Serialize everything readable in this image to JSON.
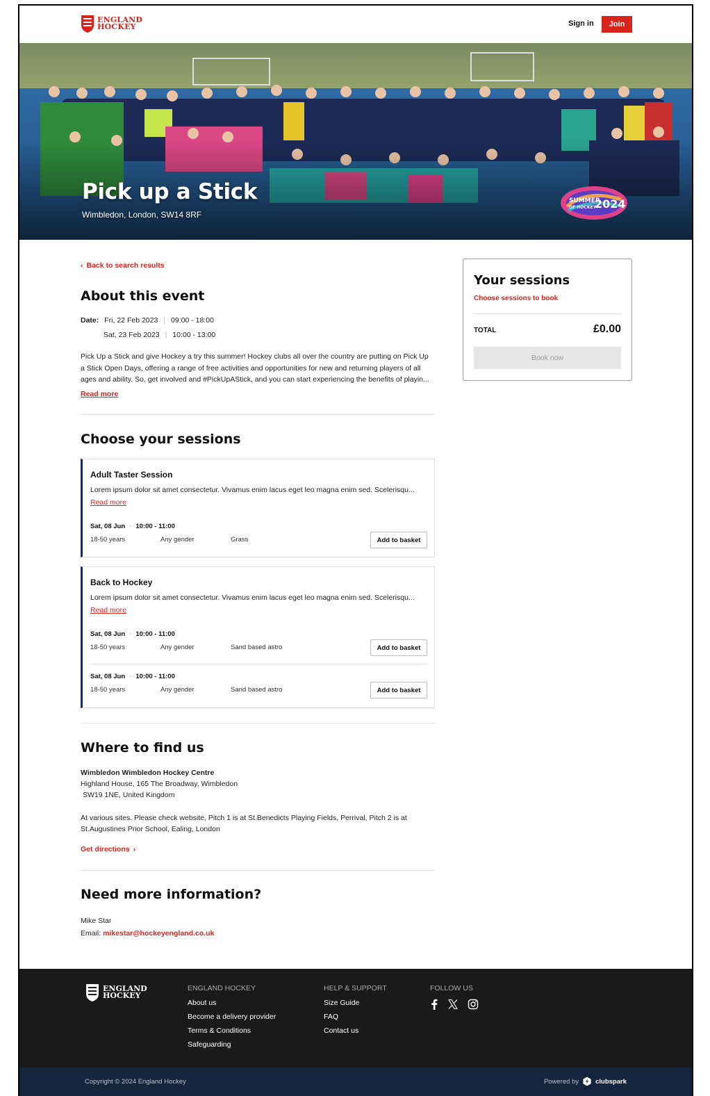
{
  "header": {
    "logo_line1": "ENGLAND",
    "logo_line2": "HOCKEY",
    "sign_in": "Sign in",
    "join": "Join"
  },
  "hero": {
    "title": "Pick up a Stick",
    "location": "Wimbledon, London, SW14 8RF",
    "badge_line1": "SUMMER",
    "badge_line2": "OF HOCKEY",
    "badge_year": "2024"
  },
  "back_link": "Back to search results",
  "about": {
    "heading": "About this event",
    "date_label": "Date:",
    "dates": [
      {
        "day": "Fri, 22 Feb 2023",
        "time": "09:00 - 18:00"
      },
      {
        "day": "Sat, 23 Feb 2023",
        "time": "10:00 - 13:00"
      }
    ],
    "description_lines": [
      "Pick Up a Stick and give Hockey a try this summer! Hockey clubs all over the country are putting on Pick Up",
      "a Stick Open Days, offering a range of free activities and opportunities for new and returning players of all",
      "ages and ability. So, get involved and #PickUpAStick, and you can start experiencing the benefits of playin..."
    ],
    "read_more": "Read more"
  },
  "sessions": {
    "heading": "Choose your sessions",
    "cards": [
      {
        "title": "Adult Taster Session",
        "description": "Lorem ipsum dolor sit amet consectetur. Vivamus enim lacus eget leo magna enim sed. Scelerisqu...",
        "read_more": "Read more",
        "slots": [
          {
            "date": "Sat, 08 Jun",
            "time": "10:00 - 11:00",
            "age": "18-50 years",
            "gender": "Any gender",
            "surface": "Grass",
            "button": "Add to basket"
          }
        ]
      },
      {
        "title": "Back to Hockey",
        "description": "Lorem ipsum dolor sit amet consectetur. Vivamus enim lacus eget leo magna enim sed. Scelerisqu...",
        "read_more": "Read more",
        "slots": [
          {
            "date": "Sat, 08 Jun",
            "time": "10:00 - 11:00",
            "age": "18-50 years",
            "gender": "Any gender",
            "surface": "Sand based astro",
            "button": "Add to basket"
          },
          {
            "date": "Sat, 08 Jun",
            "time": "10:00 - 11:00",
            "age": "18-50 years",
            "gender": "Any gender",
            "surface": "Sand based astro",
            "button": "Add to basket"
          }
        ]
      }
    ]
  },
  "location": {
    "heading": "Where to find us",
    "venue": "Wimbledon Wimbledon Hockey Centre",
    "address_line1": "Highland House, 165 The Broadway, Wimbledon",
    "address_line2": "SW19 1NE, United Kingdom",
    "note_line1": "At various sites. Please check website, Pitch 1 is at St.Benedicts Playing Fields, Perrival, Pitch 2 is at",
    "note_line2": "St.Augustines Prior School, Ealing, London",
    "directions": "Get directions"
  },
  "contact": {
    "heading": "Need more information?",
    "name": "Mike Star",
    "email_label": "Email:",
    "email": "mikestar@hockeyengland.co.uk"
  },
  "sidebar": {
    "title": "Your sessions",
    "subtitle": "Choose sessions to book",
    "total_label": "TOTAL",
    "total_amount": "£0.00",
    "book_button": "Book now"
  },
  "footer": {
    "logo_line1": "ENGLAND",
    "logo_line2": "HOCKEY",
    "col1_heading": "ENGLAND HOCKEY",
    "col1_links": [
      "About us",
      "Become a delivery provider",
      "Terms & Conditions",
      "Safeguarding"
    ],
    "col2_heading": "HELP & SUPPORT",
    "col2_links": [
      "Size Guide",
      "FAQ",
      "Contact us"
    ],
    "col3_heading": "FOLLOW US",
    "social_icons": [
      "facebook-icon",
      "x-icon",
      "instagram-icon"
    ],
    "copyright": "Copyright © 2024 England Hockey",
    "powered_by": "Powered by",
    "powered_brand": "clubspark"
  },
  "colors": {
    "brand_red": "#d9241b",
    "navy": "#1a2a5c",
    "footer_dark": "#1a1a1a",
    "footer_bottom": "#14253d"
  }
}
